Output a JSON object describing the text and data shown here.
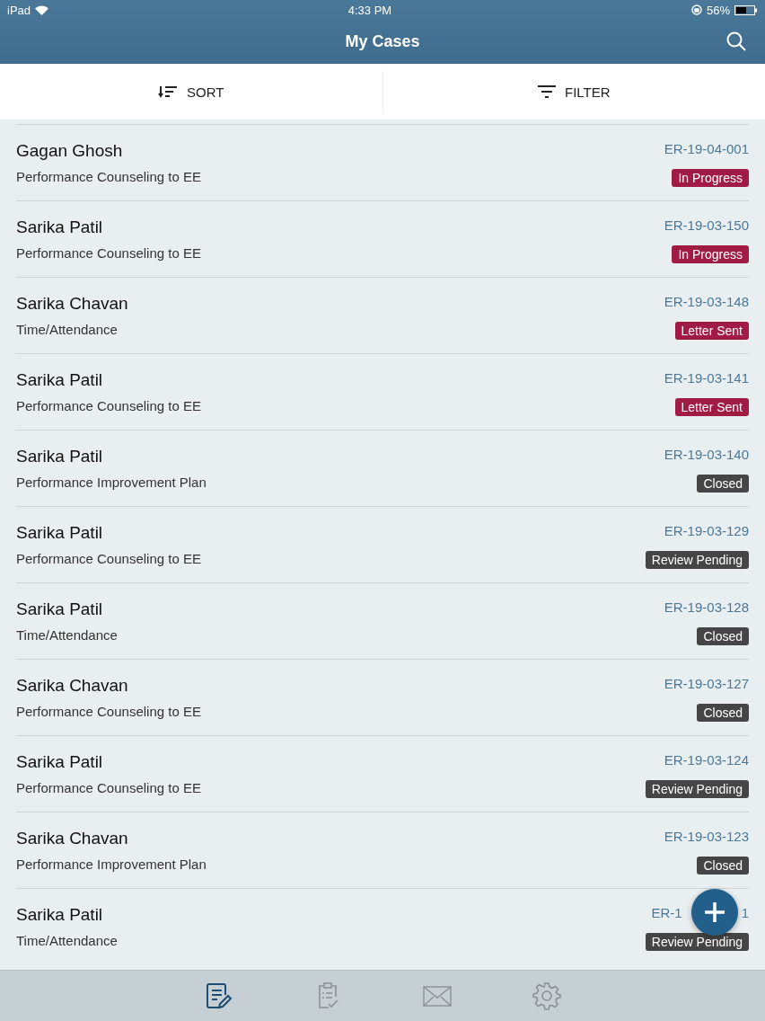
{
  "status_bar": {
    "device": "iPad",
    "time": "4:33 PM",
    "battery": "56%"
  },
  "nav": {
    "title": "My Cases"
  },
  "toolbar": [
    {
      "kind": "sort",
      "label": "SORT"
    },
    {
      "kind": "filter",
      "label": "FILTER"
    }
  ],
  "cases": [
    {
      "name": "Gagan Ghosh",
      "case_id": "ER-19-04-001",
      "type": "Performance Counseling to EE",
      "status": "In Progress",
      "color": "#a01c44"
    },
    {
      "name": "Sarika Patil",
      "case_id": "ER-19-03-150",
      "type": "Performance Counseling to EE",
      "status": "In Progress",
      "color": "#a01c44"
    },
    {
      "name": "Sarika Chavan",
      "case_id": "ER-19-03-148",
      "type": "Time/Attendance",
      "status": "Letter Sent",
      "color": "#a01c44"
    },
    {
      "name": "Sarika Patil",
      "case_id": "ER-19-03-141",
      "type": "Performance Counseling to EE",
      "status": "Letter Sent",
      "color": "#a01c44"
    },
    {
      "name": "Sarika Patil",
      "case_id": "ER-19-03-140",
      "type": "Performance Improvement Plan",
      "status": "Closed",
      "color": "#454545"
    },
    {
      "name": "Sarika Patil",
      "case_id": "ER-19-03-129",
      "type": "Performance Counseling to EE",
      "status": "Review Pending",
      "color": "#454545"
    },
    {
      "name": "Sarika Patil",
      "case_id": "ER-19-03-128",
      "type": "Time/Attendance",
      "status": "Closed",
      "color": "#454545"
    },
    {
      "name": "Sarika Chavan",
      "case_id": "ER-19-03-127",
      "type": "Performance Counseling to EE",
      "status": "Closed",
      "color": "#454545"
    },
    {
      "name": "Sarika Patil",
      "case_id": "ER-19-03-124",
      "type": "Performance Counseling to EE",
      "status": "Review Pending",
      "color": "#454545"
    },
    {
      "name": "Sarika Chavan",
      "case_id": "ER-19-03-123",
      "type": "Performance Improvement Plan",
      "status": "Closed",
      "color": "#454545"
    },
    {
      "name": "Sarika Patil",
      "case_id": "ER-1",
      "case_id_tail": "1",
      "type": "Time/Attendance",
      "status": "Review Pending",
      "color": "#454545"
    }
  ],
  "tabs": [
    {
      "kind": "cases",
      "selected": true
    },
    {
      "kind": "tasks",
      "selected": false
    },
    {
      "kind": "mail",
      "selected": false
    },
    {
      "kind": "settings",
      "selected": false
    }
  ]
}
